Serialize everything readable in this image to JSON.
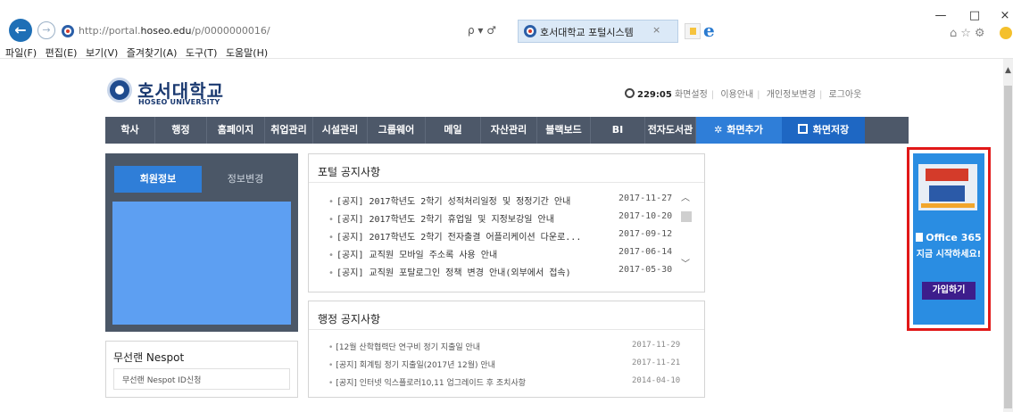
{
  "browser": {
    "url_prefix": "http://portal.",
    "url_host": "hoseo.edu",
    "url_path": "/p/0000000016/",
    "addr_tools": "ρ ▾ ♂",
    "tab_title": "호서대학교 포털시스템",
    "tab_close": "×",
    "menu": [
      "파일(F)",
      "편집(E)",
      "보기(V)",
      "즐겨찾기(A)",
      "도구(T)",
      "도움말(H)"
    ],
    "window_controls": {
      "minimize": "—",
      "maximize": "□",
      "close": "×"
    },
    "right_tools": "⌂☆⚙"
  },
  "site": {
    "logo_ko": "호서대학교",
    "logo_en": "HOSEO UNIVERSITY",
    "util": {
      "time": "229:05",
      "links": [
        "화면설정",
        "이용안내",
        "개인정보변경",
        "로그아웃"
      ]
    },
    "gnb": [
      "학사",
      "행정",
      "홈페이지",
      "취업관리",
      "시설관리",
      "그룹웨어",
      "메일",
      "자산관리",
      "블랙보드",
      "BI",
      "전자도서관"
    ],
    "gnb_add": "화면추가",
    "gnb_save": "화면저장",
    "login_tabs": [
      "회원정보",
      "정보변경"
    ],
    "nespot": {
      "title": "무선랜 Nespot",
      "link": "무선랜 Nespot ID신청"
    },
    "portal_notice": {
      "title": "포털 공지사항",
      "items": [
        {
          "text": "[공지] 2017학년도 2학기 성적처리일정 및 정정기간 안내",
          "date": "2017-11-27"
        },
        {
          "text": "[공지] 2017학년도 2학기 휴업일 및 지정보강일 안내",
          "date": "2017-10-20"
        },
        {
          "text": "[공지] 2017학년도 2학기 전자출결 어플리케이션 다운로...",
          "date": "2017-09-12"
        },
        {
          "text": "[공지] 교직원 모바일 주소록 사용 안내",
          "date": "2017-06-14"
        },
        {
          "text": "[공지] 교직원 포탈로그인 정책 변경 안내(외부에서 접속)",
          "date": "2017-05-30"
        }
      ]
    },
    "admin_notice": {
      "title": "행정 공지사항",
      "items": [
        {
          "text": "[12월 산학협력단 연구비 정기 지출일 안내",
          "date": "2017-11-29"
        },
        {
          "text": "[공지] 회계팀 정기 지출일(2017년 12월) 안내",
          "date": "2017-11-21"
        },
        {
          "text": "[공지] 인터넷 익스플로러10,11 업그레이드 후 조치사항",
          "date": "2014-04-10"
        }
      ]
    },
    "banner": {
      "product": "Office 365",
      "cta_text": "지금 시작하세요!",
      "button": "가입하기"
    }
  }
}
